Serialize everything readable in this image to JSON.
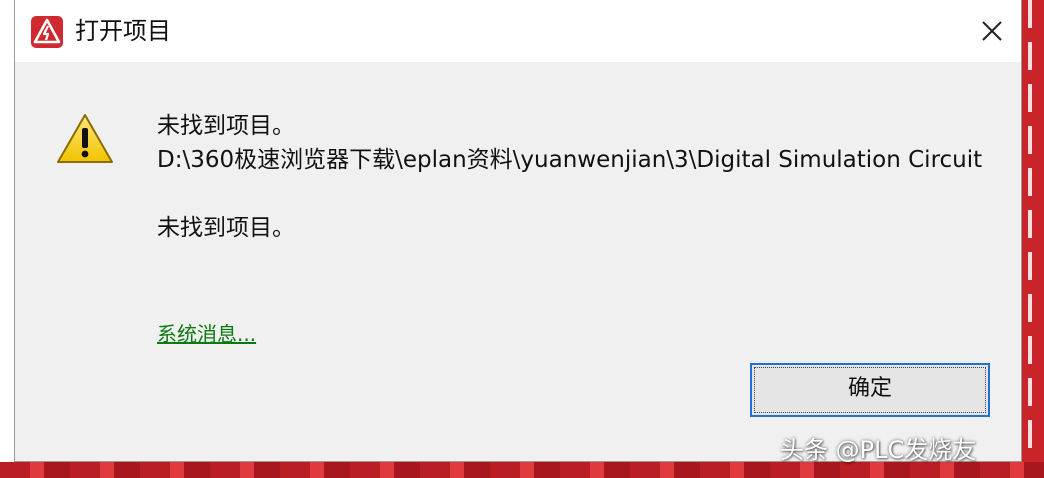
{
  "dialog": {
    "title": "打开项目",
    "message_heading": "未找到项目。",
    "message_path": "D:\\360极速浏览器下载\\eplan资料\\yuanwenjian\\3\\Digital Simulation Circuit",
    "message_detail": "未找到项目。",
    "system_message_link": "系统消息...",
    "ok_label": "确定"
  },
  "icons": {
    "app": "eplan-app-icon",
    "close": "close-icon",
    "warning": "warning-icon"
  },
  "colors": {
    "accent_border": "#1e73d2",
    "link_green": "#0a7a10",
    "brand_red": "#cf2a2f",
    "warning_yellow": "#f7d21b"
  },
  "watermark": "头条 @PLC发烧友"
}
